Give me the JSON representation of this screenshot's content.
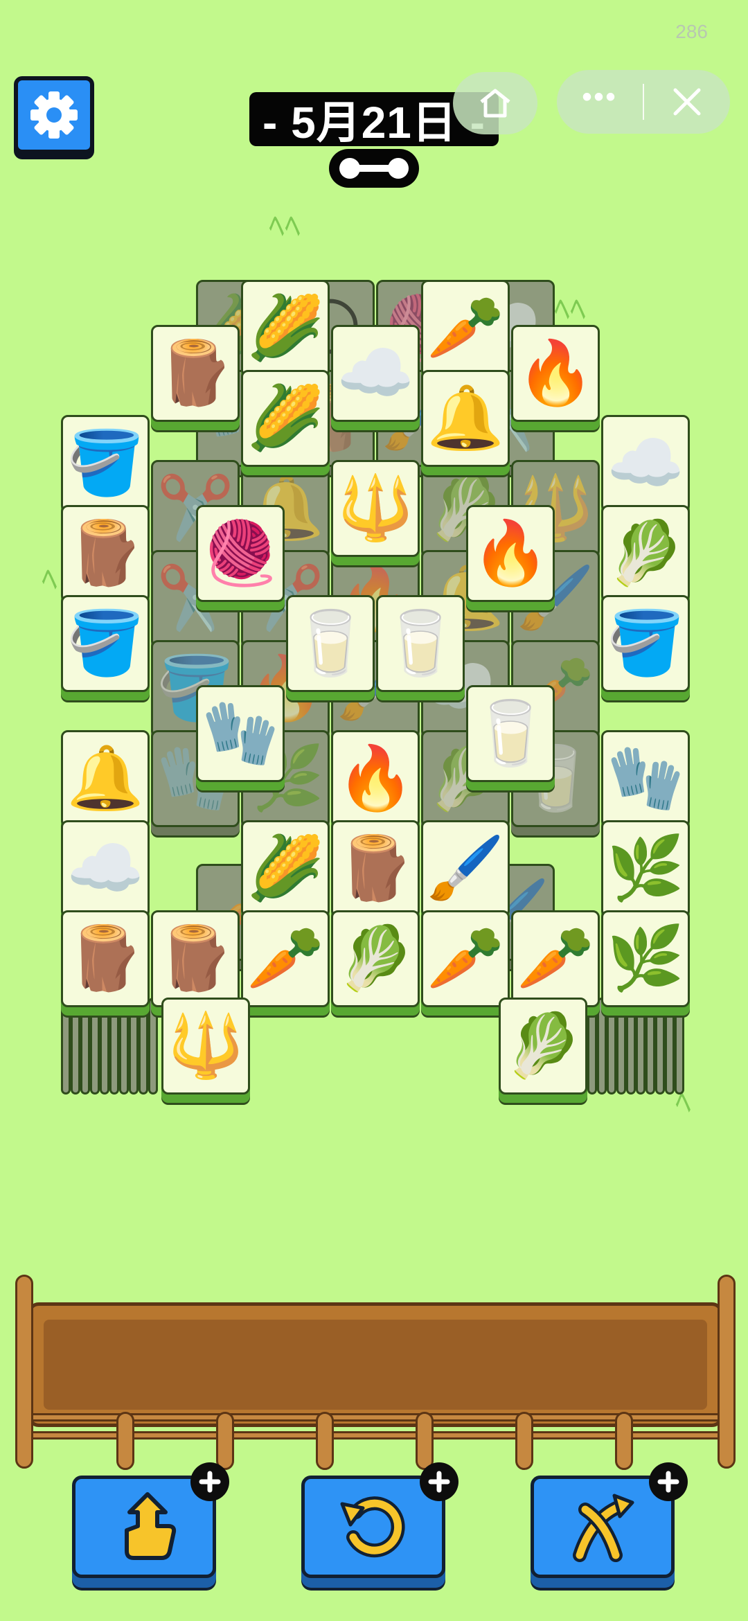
{
  "status": {
    "fps": "286"
  },
  "header": {
    "date_label": "- 5月21日 -"
  },
  "capsule": {
    "home_icon": "home-icon",
    "more_icon": "more-dots-icon",
    "more_label": "•••",
    "close_icon": "close-icon"
  },
  "board": {
    "top_layer": [
      {
        "item": "corn"
      },
      {
        "item": "carrot"
      },
      {
        "item": "stump"
      },
      {
        "item": "cotton"
      },
      {
        "item": "campfire"
      },
      {
        "item": "corn"
      },
      {
        "item": "bell"
      },
      {
        "item": "bucket"
      },
      {
        "item": "cotton"
      },
      {
        "item": "stump"
      },
      {
        "item": "pitchfork"
      },
      {
        "item": "cabbage"
      },
      {
        "item": "yarn"
      },
      {
        "item": "campfire"
      },
      {
        "item": "bucket"
      },
      {
        "item": "milk"
      },
      {
        "item": "milk"
      },
      {
        "item": "bucket"
      },
      {
        "item": "glove"
      },
      {
        "item": "milk"
      },
      {
        "item": "bell"
      },
      {
        "item": "campfire"
      },
      {
        "item": "glove"
      },
      {
        "item": "cotton"
      },
      {
        "item": "corn"
      },
      {
        "item": "stump"
      },
      {
        "item": "brush"
      },
      {
        "item": "grass"
      },
      {
        "item": "stump"
      },
      {
        "item": "stump"
      },
      {
        "item": "carrot"
      },
      {
        "item": "cabbage"
      },
      {
        "item": "carrot"
      },
      {
        "item": "carrot"
      },
      {
        "item": "grass"
      },
      {
        "item": "pitchfork"
      },
      {
        "item": "cabbage"
      }
    ]
  },
  "tools": [
    {
      "name": "remove-tiles",
      "icon": "hand-up-icon"
    },
    {
      "name": "undo",
      "icon": "undo-icon"
    },
    {
      "name": "shuffle",
      "icon": "shuffle-icon"
    }
  ],
  "colors": {
    "background": "#c2f98c",
    "tile_face": "#f6fbdc",
    "tile_edge": "#58a832",
    "button_blue": "#2e93f5",
    "fence_wood": "#b8772f"
  }
}
